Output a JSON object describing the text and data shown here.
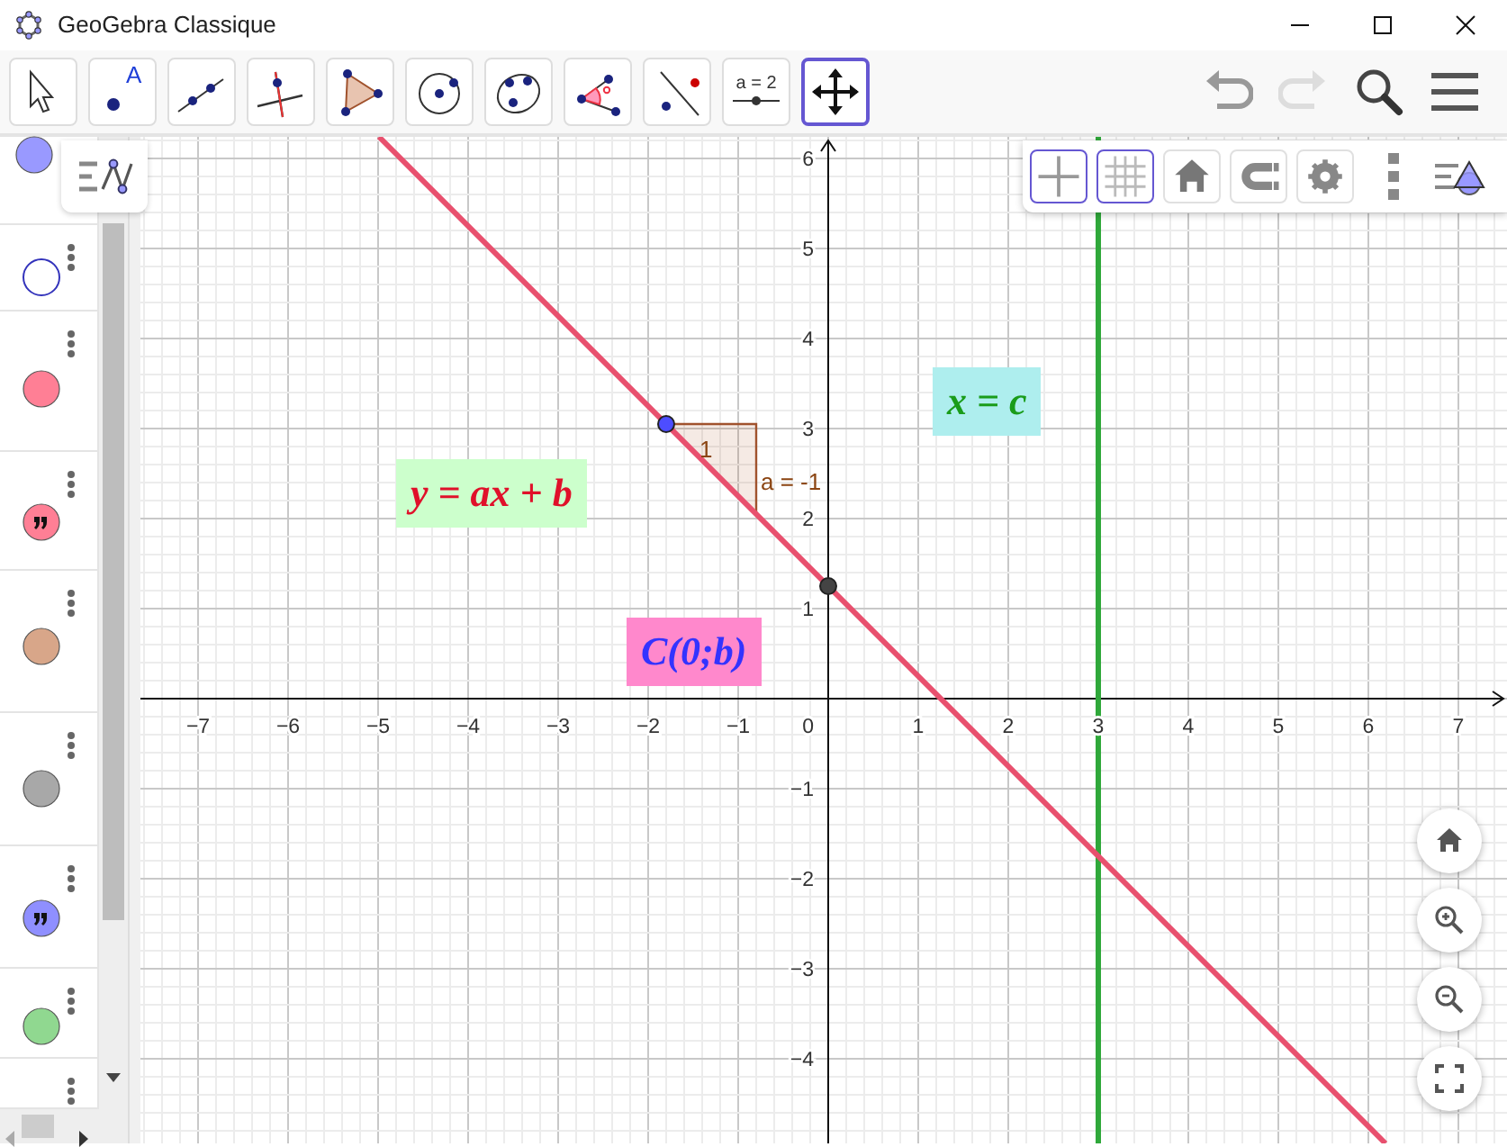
{
  "window": {
    "title": "GeoGebra Classique"
  },
  "toolbar": {
    "tools": [
      {
        "kind": "pointer",
        "selected": false
      },
      {
        "kind": "point",
        "icon_text": "A",
        "selected": false
      },
      {
        "kind": "line",
        "selected": false
      },
      {
        "kind": "perpendicular",
        "selected": false
      },
      {
        "kind": "polygon",
        "selected": false
      },
      {
        "kind": "circle",
        "selected": false
      },
      {
        "kind": "conic",
        "selected": false
      },
      {
        "kind": "angle",
        "selected": false
      },
      {
        "kind": "reflect",
        "selected": false
      },
      {
        "kind": "slider",
        "label": "a = 2",
        "selected": false
      },
      {
        "kind": "move-view",
        "selected": true
      }
    ],
    "undo": {
      "disabled": false
    },
    "redo": {
      "disabled": true
    }
  },
  "algebra_view": {
    "items": [
      {
        "kind": "object",
        "color": "#9999ff",
        "visible": true
      },
      {
        "kind": "object",
        "color": "#3333bb",
        "visible": false
      },
      {
        "kind": "object",
        "color": "#ff7f95",
        "visible": true
      },
      {
        "kind": "text",
        "color": "#ff7f95",
        "visible": true
      },
      {
        "kind": "object",
        "color": "#d8a689",
        "visible": true
      },
      {
        "kind": "object",
        "color": "#a8a8a8",
        "visible": true
      },
      {
        "kind": "text",
        "color": "#8f8fff",
        "visible": true
      },
      {
        "kind": "object",
        "color": "#90d890",
        "visible": true
      },
      {
        "kind": "cut"
      }
    ]
  },
  "graphics": {
    "style_bar": {
      "buttons": [
        {
          "kind": "axes",
          "selected": true
        },
        {
          "kind": "grid",
          "selected": true
        },
        {
          "kind": "home",
          "selected": false
        },
        {
          "kind": "magnet",
          "selected": false
        },
        {
          "kind": "settings",
          "selected": false
        },
        {
          "kind": "more",
          "selected": false
        },
        {
          "kind": "views",
          "selected": false
        }
      ]
    },
    "chart_data": {
      "type": "line",
      "x": [
        -4.99,
        6.19
      ],
      "series": [
        {
          "name": "y = ax + b",
          "color": "#e8506e",
          "values": [
            6.24,
            -4.94
          ]
        }
      ],
      "grid": true,
      "ref_lines": [
        {
          "axis": "x",
          "value": 3,
          "color": "#2fa83a"
        }
      ],
      "xlim": [
        -7.64,
        7.54
      ],
      "ylim": [
        -4.94,
        6.24
      ],
      "xticks": [
        {
          "value": -7,
          "label": "−7"
        },
        {
          "value": -6,
          "label": "−6"
        },
        {
          "value": -5,
          "label": "−5"
        },
        {
          "value": -4,
          "label": "−4"
        },
        {
          "value": -3,
          "label": "−3"
        },
        {
          "value": -2,
          "label": "−2"
        },
        {
          "value": -1,
          "label": "−1"
        },
        {
          "value": 1,
          "label": "1"
        },
        {
          "value": 2,
          "label": "2"
        },
        {
          "value": 3,
          "label": "3"
        },
        {
          "value": 4,
          "label": "4"
        },
        {
          "value": 5,
          "label": "5"
        },
        {
          "value": 6,
          "label": "6"
        },
        {
          "value": 7,
          "label": "7"
        }
      ],
      "yticks": [
        {
          "value": -4,
          "label": "−4"
        },
        {
          "value": -3,
          "label": "−3"
        },
        {
          "value": -2,
          "label": "−2"
        },
        {
          "value": -1,
          "label": "−1"
        },
        {
          "value": 1,
          "label": "1"
        },
        {
          "value": 2,
          "label": "2"
        },
        {
          "value": 3,
          "label": "3"
        },
        {
          "value": 4,
          "label": "4"
        },
        {
          "value": 5,
          "label": "5"
        },
        {
          "value": 6,
          "label": "6"
        }
      ]
    },
    "origin_label": "0",
    "slope": {
      "run_label": "1",
      "label": "a = -1"
    },
    "points": [
      {
        "color": "#4d4dff"
      },
      {
        "color": "#444444"
      }
    ],
    "labels": [
      {
        "text": "x = c"
      },
      {
        "text": "C(0;b)"
      }
    ],
    "view_buttons": [
      {
        "kind": "home"
      },
      {
        "kind": "zoom-in"
      },
      {
        "kind": "zoom-out"
      },
      {
        "kind": "fullscreen"
      }
    ]
  }
}
